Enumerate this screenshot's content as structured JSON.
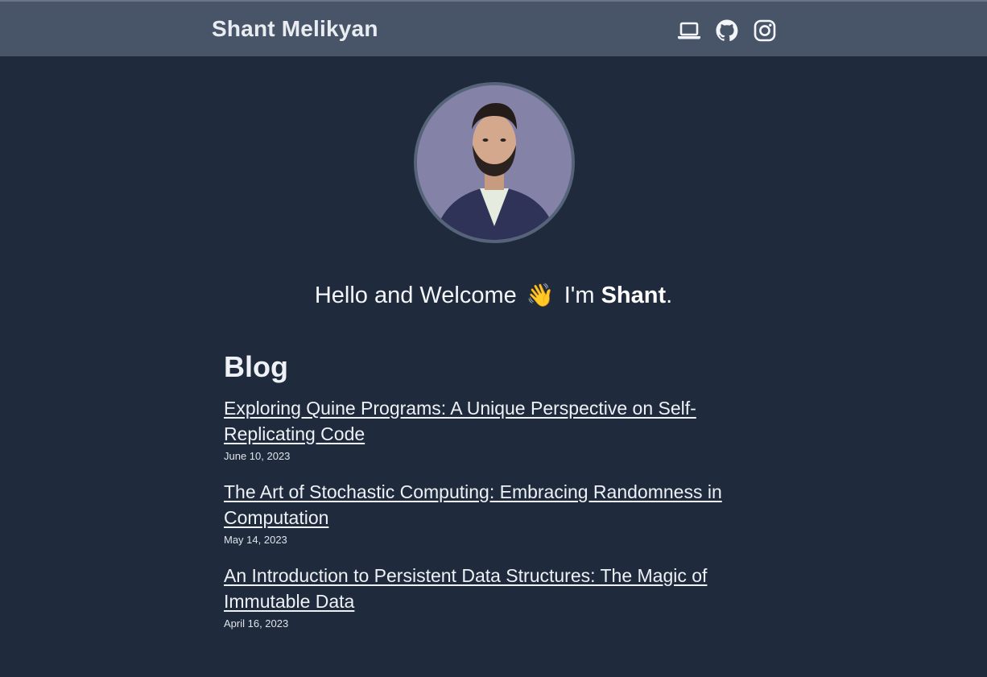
{
  "header": {
    "site_title": "Shant Melikyan",
    "icons": [
      "laptop-icon",
      "github-icon",
      "instagram-icon"
    ]
  },
  "hero": {
    "greeting_prefix": "Hello and Welcome",
    "wave_emoji": "👋",
    "greeting_im": "I'm",
    "name": "Shant",
    "period": "."
  },
  "blog": {
    "heading": "Blog",
    "posts": [
      {
        "title": "Exploring Quine Programs: A Unique Perspective on Self-Replicating Code",
        "date": "June 10, 2023"
      },
      {
        "title": "The Art of Stochastic Computing: Embracing Randomness in Computation",
        "date": "May 14, 2023"
      },
      {
        "title": "An Introduction to Persistent Data Structures: The Magic of Immutable Data",
        "date": "April 16, 2023"
      }
    ]
  },
  "colors": {
    "background": "#1f2a3c",
    "header": "#485569",
    "text": "#eef1f5",
    "avatar_border": "#566479"
  }
}
